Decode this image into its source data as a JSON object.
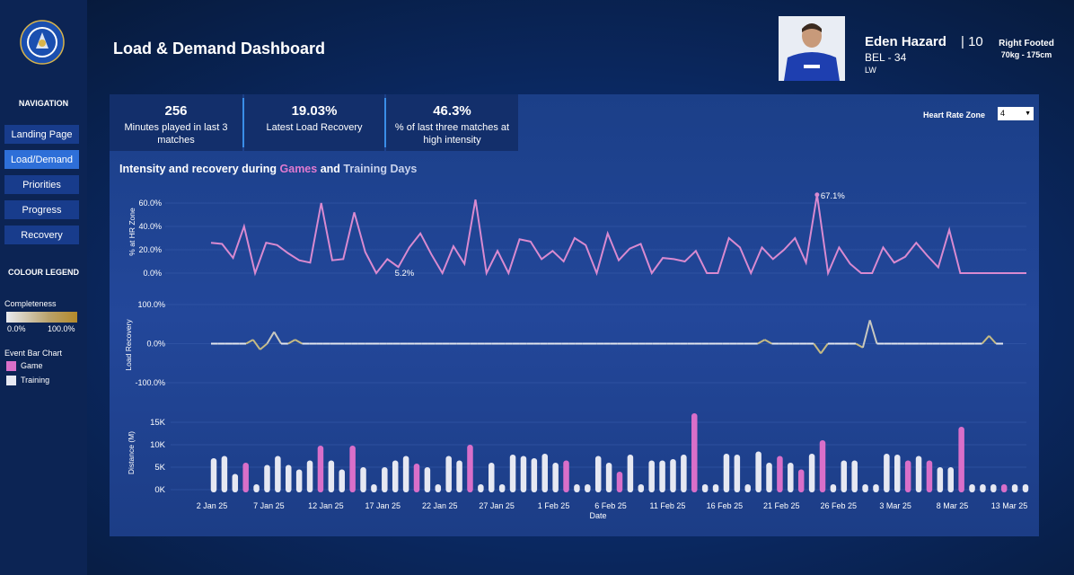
{
  "header": {
    "title": "Load & Demand Dashboard"
  },
  "player": {
    "name": "Eden Hazard",
    "number": "| 10",
    "nation_age": "BEL - 34",
    "position": "LW",
    "foot": "Right Footed",
    "size": "70kg - 175cm"
  },
  "sidebar": {
    "nav_heading": "NAVIGATION",
    "items": [
      {
        "label": "Landing Page",
        "active": false
      },
      {
        "label": "Load/Demand",
        "active": true
      },
      {
        "label": "Priorities",
        "active": false
      },
      {
        "label": "Progress",
        "active": false
      },
      {
        "label": "Recovery",
        "active": false
      }
    ],
    "legend_heading": "COLOUR LEGEND",
    "completeness_label": "Completeness",
    "completeness_min": "0.0%",
    "completeness_max": "100.0%",
    "event_label": "Event Bar Chart",
    "game_label": "Game",
    "training_label": "Training",
    "game_color": "#d96fc9",
    "training_color": "#e6e8f2"
  },
  "kpis": [
    {
      "value": "256",
      "label": "Minutes played in last 3 matches"
    },
    {
      "value": "19.03%",
      "label": "Latest Load Recovery"
    },
    {
      "value": "46.3%",
      "label": "% of last three matches at high intensity"
    }
  ],
  "filter": {
    "label": "Heart Rate Zone",
    "value": "4"
  },
  "chart_title": {
    "prefix": "Intensity and recovery during ",
    "games": "Games",
    "and": " and ",
    "training": "Training Days"
  },
  "chart_data": [
    {
      "type": "line",
      "ylabel": "% at HR Zone",
      "y_ticks": [
        "60.0%",
        "40.0%",
        "20.0%",
        "0.0%"
      ],
      "ylim": [
        0,
        67
      ],
      "color": "#d98ad0",
      "annotations": [
        {
          "label": "67.1%",
          "index": 60
        },
        {
          "label": "5.2%",
          "index": 16
        }
      ],
      "values": [
        26,
        25,
        13,
        40,
        0,
        26,
        24,
        17,
        11,
        9,
        60,
        11,
        12,
        52,
        18,
        0,
        12,
        5.2,
        22,
        34,
        16,
        0,
        23,
        8,
        63,
        0,
        19,
        0,
        29,
        27,
        12,
        19,
        10,
        30,
        24,
        0,
        34,
        11,
        21,
        25,
        0,
        13,
        12,
        10,
        19,
        0,
        0,
        30,
        22,
        0,
        22,
        12,
        20,
        30,
        9,
        67.1,
        0,
        22,
        8,
        0,
        0,
        22,
        9,
        14,
        26,
        15,
        5,
        37,
        0,
        0,
        0,
        0,
        0,
        0,
        0
      ]
    },
    {
      "type": "line",
      "ylabel": "Load Recovery",
      "y_ticks": [
        "100.0%",
        "0.0%",
        "-100.0%"
      ],
      "ylim": [
        -100,
        100
      ],
      "values": [
        0,
        0,
        0,
        0,
        0,
        0,
        10,
        -15,
        0,
        30,
        0,
        0,
        10,
        0,
        0,
        0,
        0,
        0,
        0,
        0,
        0,
        0,
        0,
        0,
        0,
        0,
        0,
        0,
        0,
        0,
        0,
        0,
        0,
        0,
        0,
        0,
        0,
        0,
        0,
        0,
        0,
        0,
        0,
        0,
        0,
        0,
        0,
        0,
        0,
        0,
        0,
        0,
        0,
        0,
        0,
        0,
        0,
        0,
        0,
        0,
        0,
        0,
        0,
        0,
        0,
        0,
        0,
        0,
        0,
        0,
        0,
        0,
        0,
        0,
        0,
        0,
        0,
        0,
        0,
        10,
        0,
        0,
        0,
        0,
        0,
        0,
        0,
        -25,
        0,
        0,
        0,
        0,
        0,
        -10,
        60,
        0,
        0,
        0,
        0,
        0,
        0,
        0,
        0,
        0,
        0,
        0,
        0,
        0,
        0,
        0,
        0,
        20,
        0,
        0
      ]
    },
    {
      "type": "bar",
      "ylabel": "Distance (M)",
      "y_ticks": [
        "15K",
        "10K",
        "5K",
        "0K"
      ],
      "ylim": [
        0,
        17000
      ],
      "xlabel": "Date",
      "x_ticks": [
        "2 Jan 25",
        "7 Jan 25",
        "12 Jan 25",
        "17 Jan 25",
        "22 Jan 25",
        "27 Jan 25",
        "1 Feb 25",
        "6 Feb 25",
        "11 Feb 25",
        "16 Feb 25",
        "21 Feb 25",
        "26 Feb 25",
        "3 Mar 25",
        "8 Mar 25",
        "13 Mar 25"
      ],
      "events": [
        [
          "t",
          7000
        ],
        [
          "t",
          7500
        ],
        [
          "t",
          3500
        ],
        [
          "g",
          6000
        ],
        [
          "t",
          1200
        ],
        [
          "t",
          5500
        ],
        [
          "t",
          7500
        ],
        [
          "t",
          5500
        ],
        [
          "t",
          4500
        ],
        [
          "t",
          6500
        ],
        [
          "g",
          9800
        ],
        [
          "t",
          6500
        ],
        [
          "t",
          4500
        ],
        [
          "g",
          9800
        ],
        [
          "t",
          5000
        ],
        [
          "t",
          1200
        ],
        [
          "t",
          5000
        ],
        [
          "t",
          6500
        ],
        [
          "t",
          7500
        ],
        [
          "g",
          5800
        ],
        [
          "t",
          5000
        ],
        [
          "t",
          1200
        ],
        [
          "t",
          7500
        ],
        [
          "t",
          6500
        ],
        [
          "g",
          10000
        ],
        [
          "t",
          1200
        ],
        [
          "t",
          6000
        ],
        [
          "t",
          1200
        ],
        [
          "t",
          7800
        ],
        [
          "t",
          7500
        ],
        [
          "t",
          7000
        ],
        [
          "t",
          8000
        ],
        [
          "t",
          6000
        ],
        [
          "g",
          6500
        ],
        [
          "t",
          1200
        ],
        [
          "t",
          1200
        ],
        [
          "t",
          7500
        ],
        [
          "t",
          6000
        ],
        [
          "g",
          4000
        ],
        [
          "t",
          7800
        ],
        [
          "t",
          1200
        ],
        [
          "t",
          6500
        ],
        [
          "t",
          6500
        ],
        [
          "t",
          6800
        ],
        [
          "t",
          7800
        ],
        [
          "g",
          17000
        ],
        [
          "t",
          1200
        ],
        [
          "t",
          1200
        ],
        [
          "t",
          8000
        ],
        [
          "t",
          7800
        ],
        [
          "t",
          1200
        ],
        [
          "t",
          8500
        ],
        [
          "t",
          6000
        ],
        [
          "g",
          7500
        ],
        [
          "t",
          6000
        ],
        [
          "g",
          4500
        ],
        [
          "t",
          8000
        ],
        [
          "g",
          11000
        ],
        [
          "t",
          1200
        ],
        [
          "t",
          6500
        ],
        [
          "t",
          6500
        ],
        [
          "t",
          1200
        ],
        [
          "t",
          1200
        ],
        [
          "t",
          8000
        ],
        [
          "t",
          7800
        ],
        [
          "g",
          6500
        ],
        [
          "t",
          7500
        ],
        [
          "g",
          6500
        ],
        [
          "t",
          5000
        ],
        [
          "t",
          5000
        ],
        [
          "g",
          14000
        ],
        [
          "t",
          1200
        ],
        [
          "t",
          1200
        ],
        [
          "t",
          1200
        ],
        [
          "g",
          1200
        ],
        [
          "t",
          1200
        ],
        [
          "t",
          1200
        ]
      ]
    }
  ]
}
